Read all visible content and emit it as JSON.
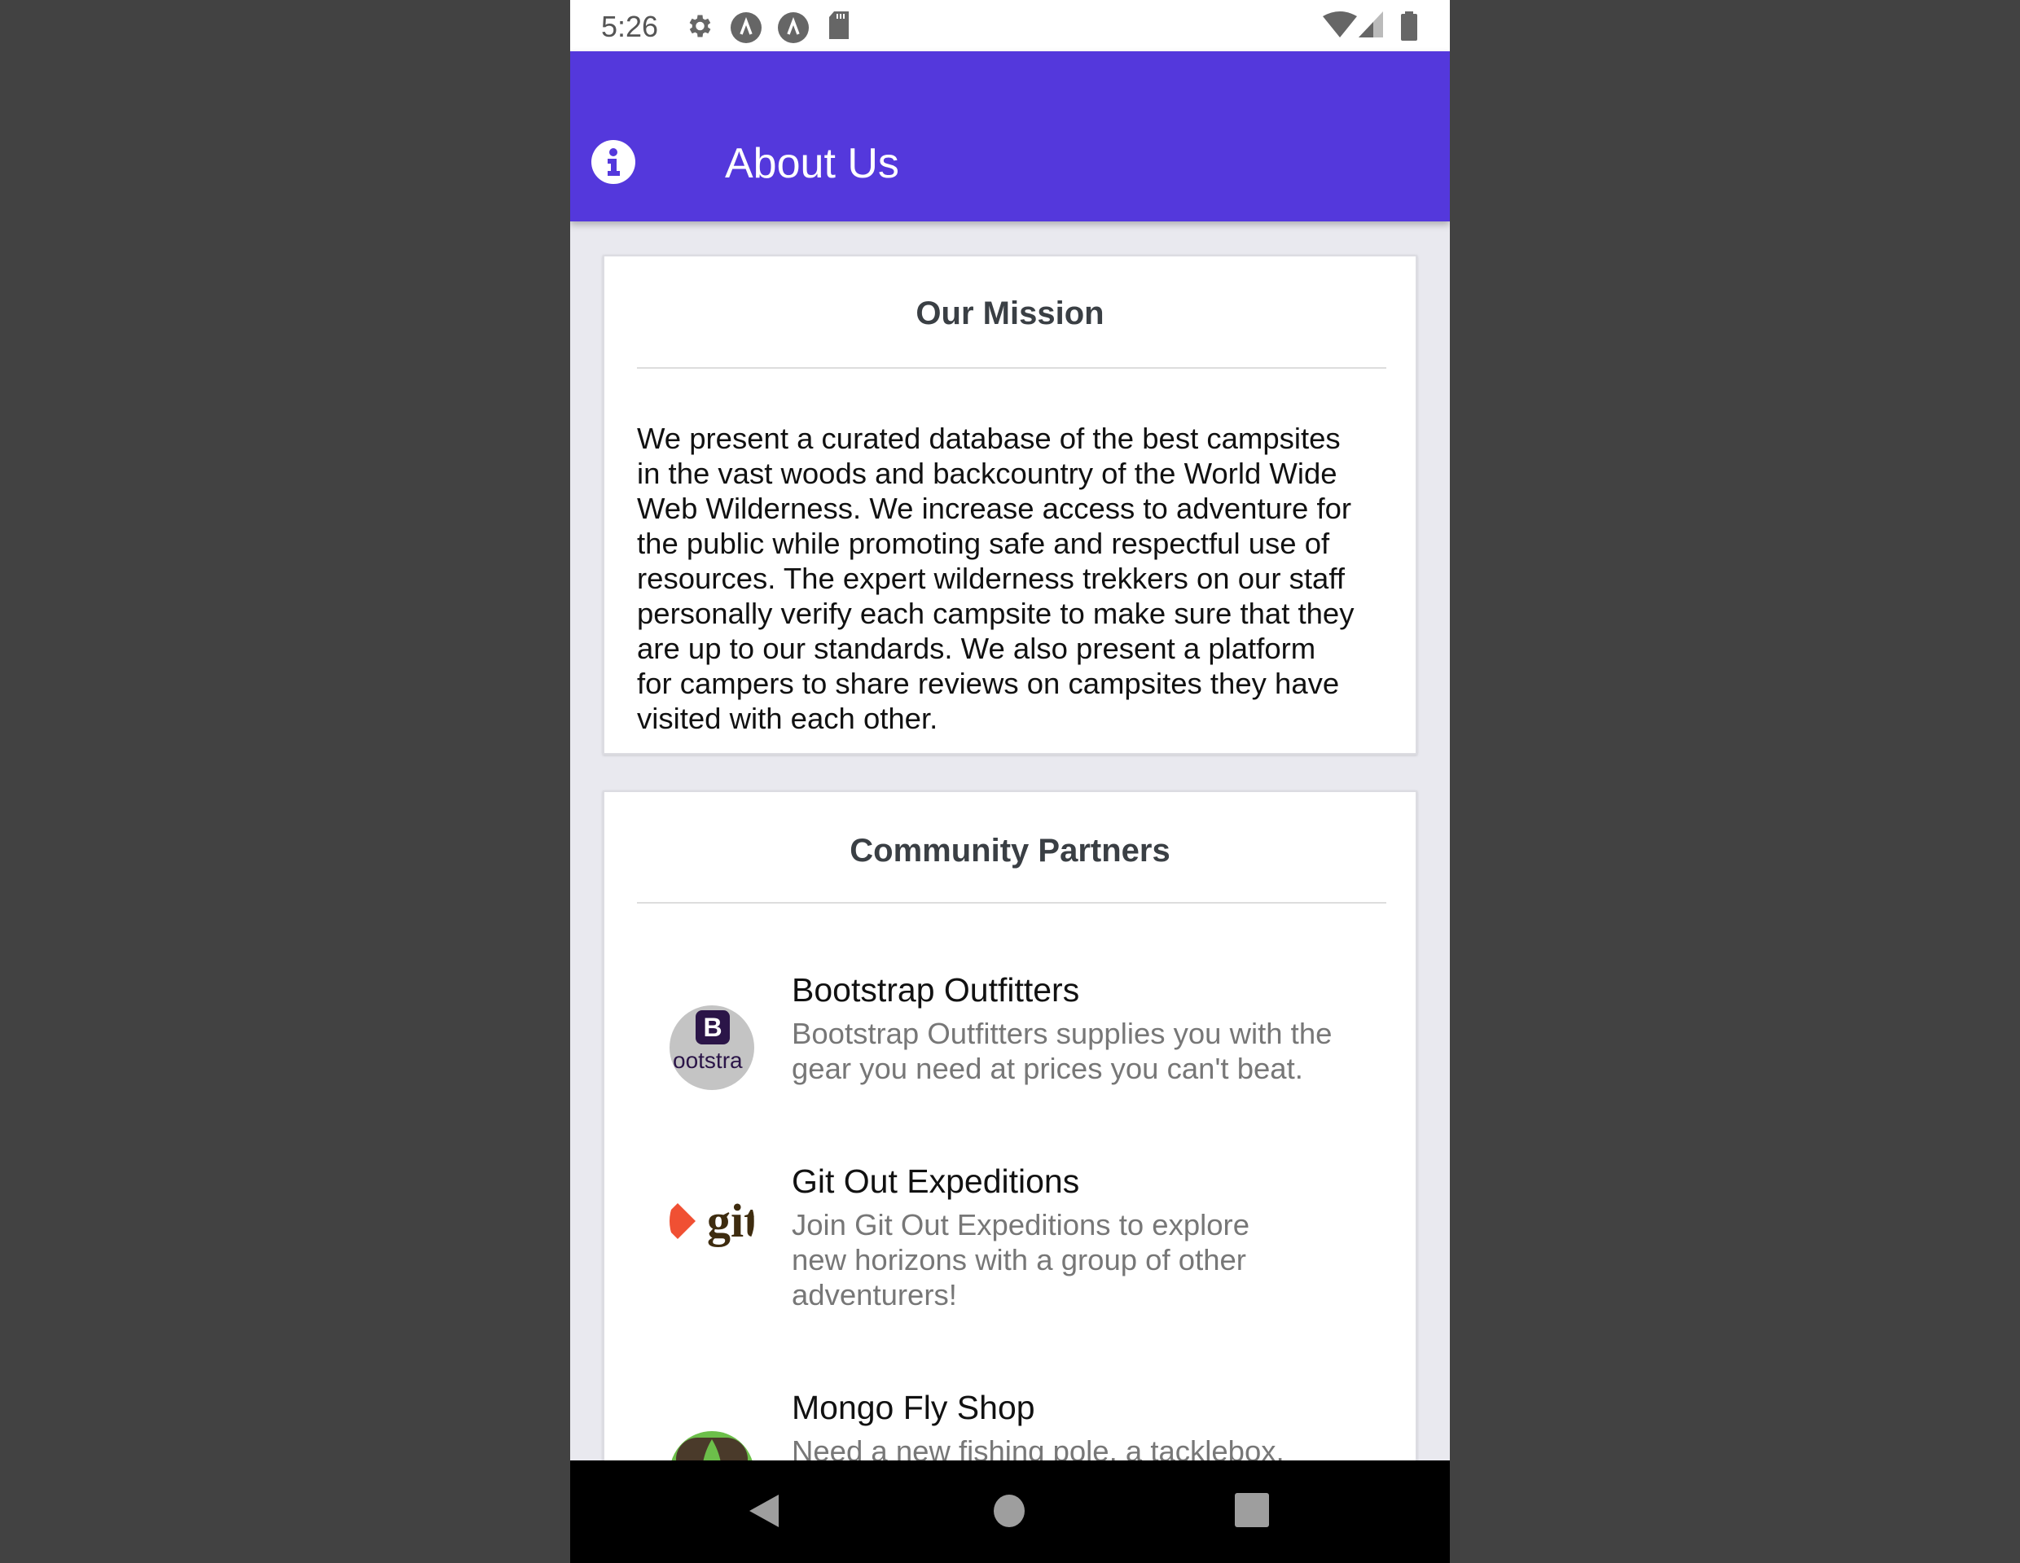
{
  "status_bar": {
    "time": "5:26",
    "icons": [
      "settings-icon",
      "app-notification-icon",
      "app-notification-icon",
      "sd-card-icon",
      "wifi-icon",
      "signal-icon",
      "battery-icon"
    ]
  },
  "app_bar": {
    "title": "About Us",
    "icon": "info-icon",
    "color": "#5438dc"
  },
  "mission": {
    "title": "Our Mission",
    "lines": [
      "We present a curated database of the best campsites",
      "in the vast woods and backcountry of the World Wide",
      "Web Wilderness. We increase access to adventure for",
      "the public while promoting safe and respectful use of",
      "resources. The expert wilderness trekkers on our staff",
      "personally verify each campsite to make sure that they",
      "are up to our standards. We also present a platform",
      "for campers to share reviews on campsites they have",
      "visited with each other."
    ]
  },
  "partners": {
    "title": "Community Partners",
    "items": [
      {
        "name": "Bootstrap Outfitters",
        "logo_text": "ootstra",
        "logo_letter": "B",
        "desc": [
          "Bootstrap Outfitters supplies you with the",
          "gear you need at prices you can't beat."
        ]
      },
      {
        "name": "Git Out Expeditions",
        "logo_text": "git",
        "desc": [
          "Join Git Out Expeditions to explore",
          "new horizons with a group of other",
          "adventurers!"
        ]
      },
      {
        "name": "Mongo Fly Shop",
        "desc": [
          "Need a new fishing pole, a tacklebox,"
        ]
      }
    ]
  },
  "nav": {
    "icons": [
      "back-icon",
      "home-icon",
      "recents-icon"
    ]
  }
}
